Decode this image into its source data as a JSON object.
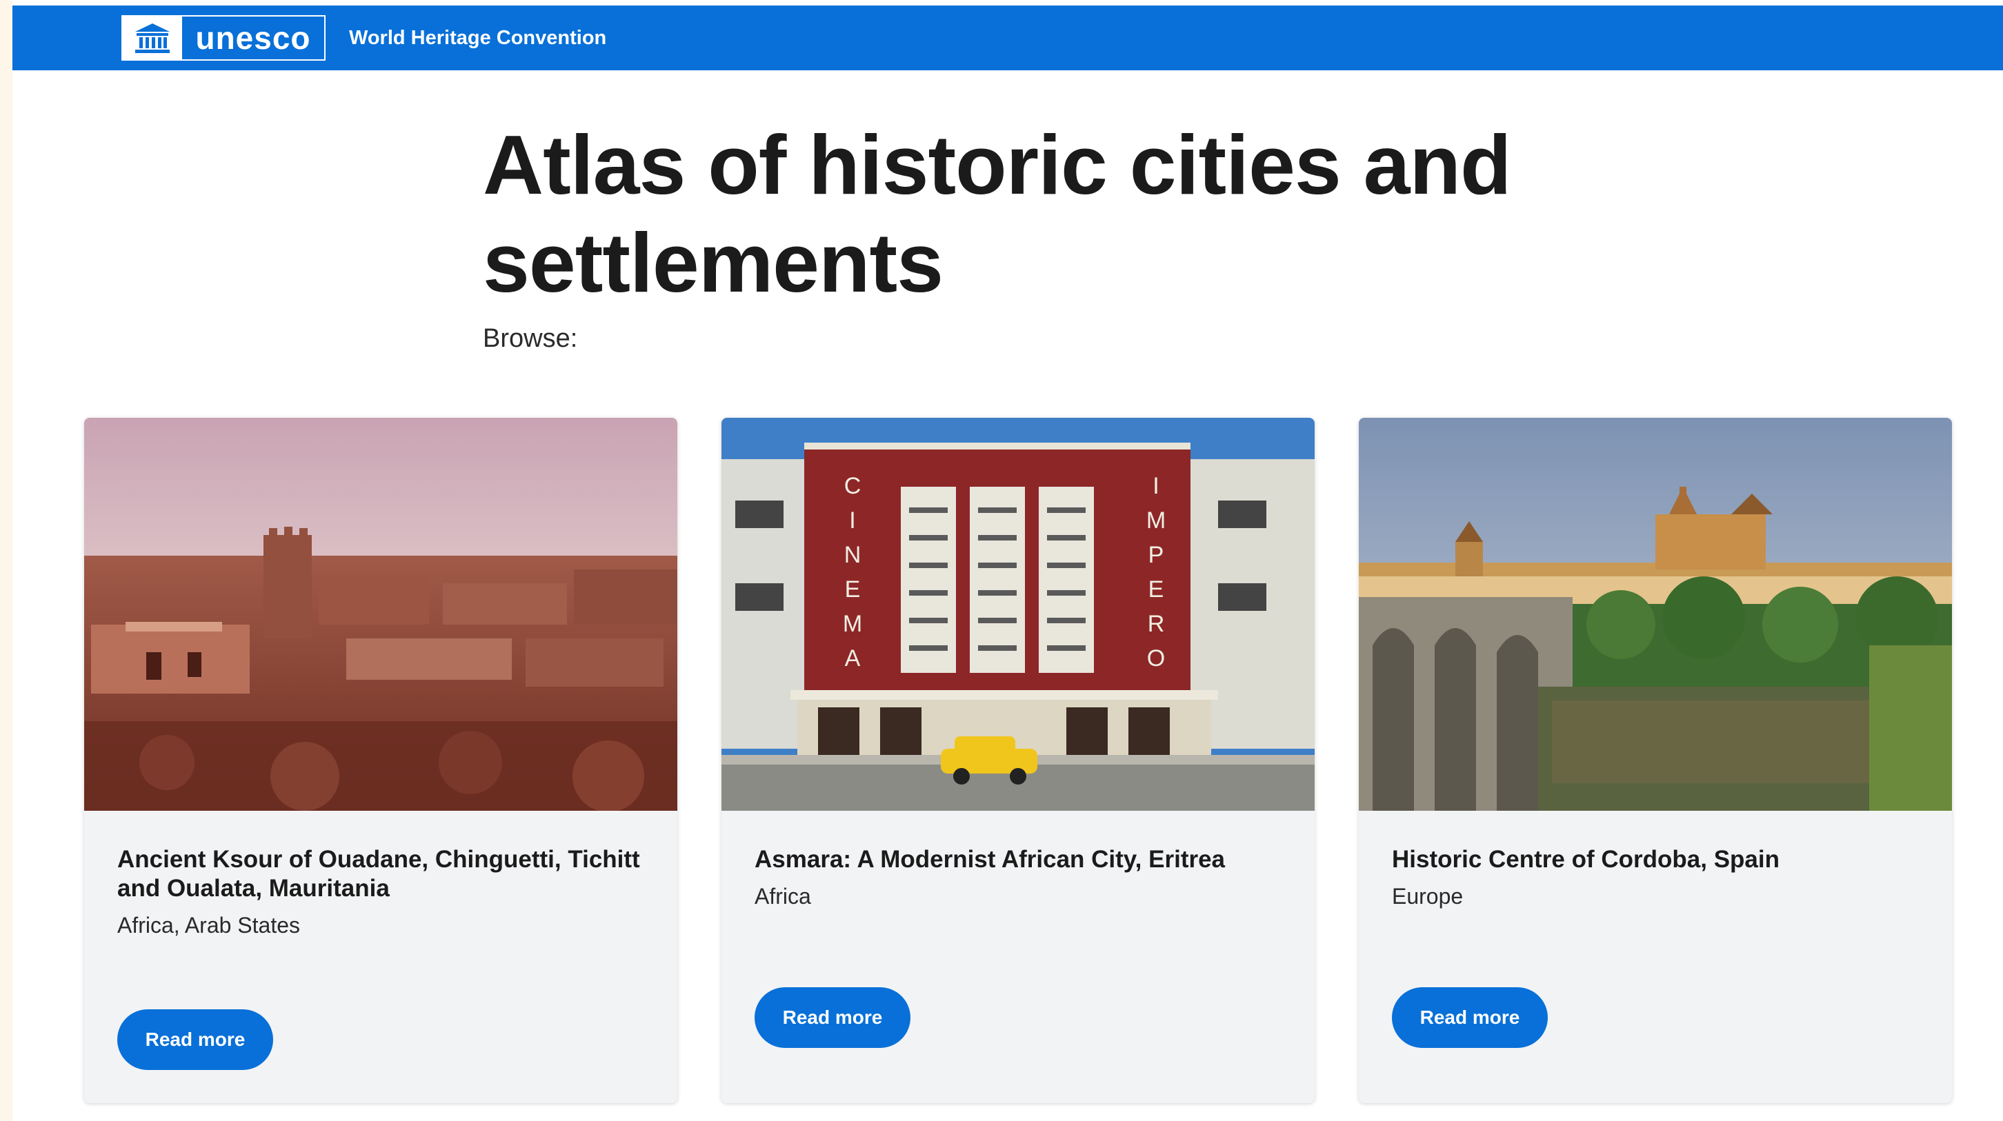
{
  "header": {
    "logo_text": "unesco",
    "title": "World Heritage Convention"
  },
  "page": {
    "title": "Atlas of historic cities and settlements",
    "browse_label": "Browse:"
  },
  "cards": [
    {
      "title": "Ancient Ksour of Ouadane, Chinguetti, Tichitt and Oualata, Mauritania",
      "region": "Africa, Arab States",
      "button_label": "Read more",
      "image": "desert-ksour-ruins-photo"
    },
    {
      "title": "Asmara: A Modernist African City, Eritrea",
      "region": "Africa",
      "button_label": "Read more",
      "image": "cinema-impero-facade-photo",
      "sign_left": "CINEMA",
      "sign_right": "IMPERO"
    },
    {
      "title": "Historic Centre of Cordoba, Spain",
      "region": "Europe",
      "button_label": "Read more",
      "image": "cordoba-bridge-river-photo"
    }
  ],
  "colors": {
    "brand_blue": "#0870d8",
    "card_bg": "#f2f3f5"
  }
}
